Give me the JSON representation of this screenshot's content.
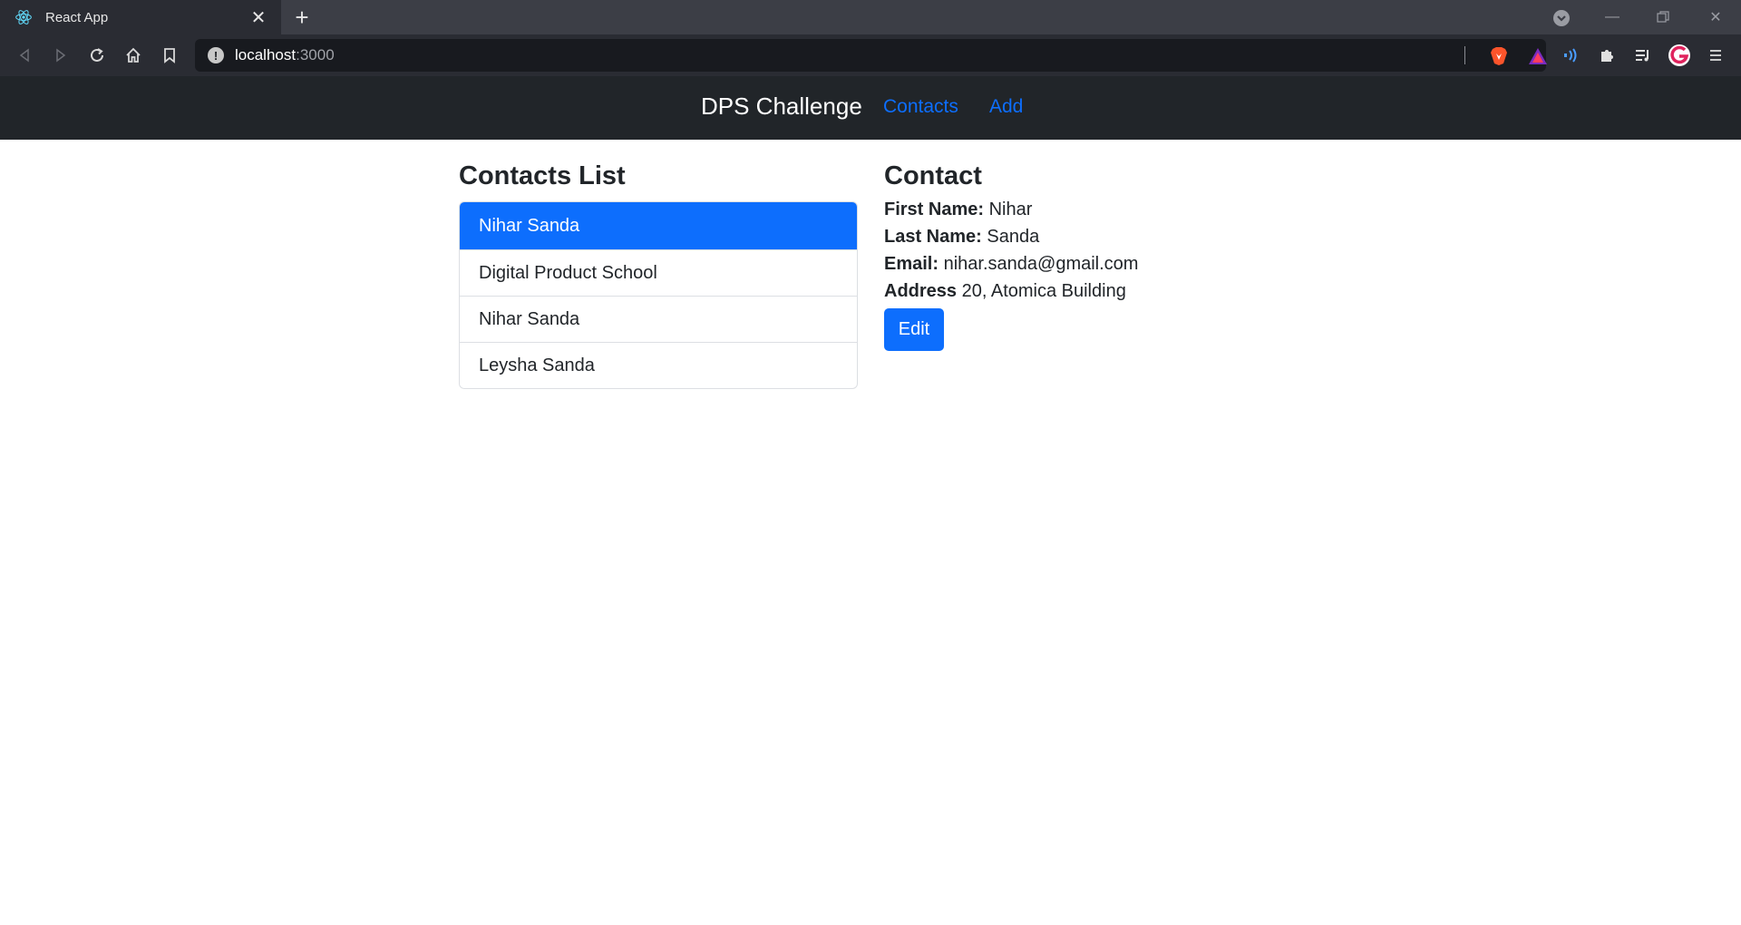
{
  "browser": {
    "tab_title": "React App",
    "url_host": "localhost",
    "url_port": ":3000"
  },
  "navbar": {
    "brand": "DPS Challenge",
    "links": [
      "Contacts",
      "Add"
    ]
  },
  "contacts_list": {
    "title": "Contacts List",
    "items": [
      "Nihar Sanda",
      "Digital Product School",
      "Nihar Sanda",
      "Leysha Sanda"
    ],
    "active_index": 0
  },
  "contact": {
    "title": "Contact",
    "first_name_label": "First Name:",
    "first_name": "Nihar",
    "last_name_label": "Last Name:",
    "last_name": "Sanda",
    "email_label": "Email:",
    "email": "nihar.sanda@gmail.com",
    "address_label": "Address",
    "address": "20, Atomica Building",
    "edit_label": "Edit"
  },
  "colors": {
    "primary": "#0d6efd",
    "navbar_bg": "#212529",
    "chrome_bg": "#2a2c33"
  }
}
